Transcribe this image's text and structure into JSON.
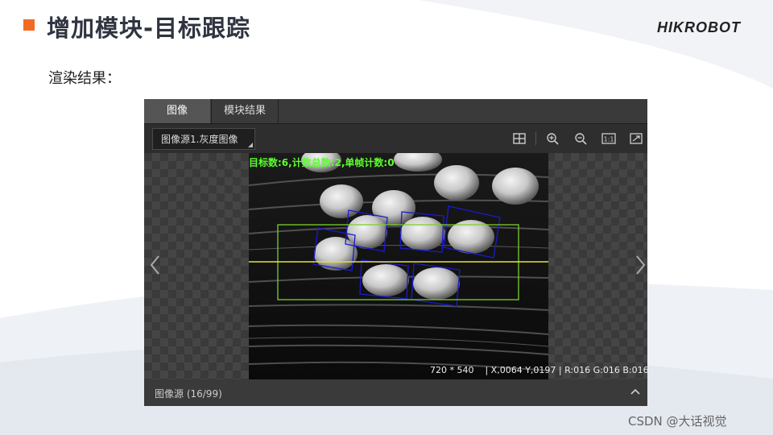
{
  "slide": {
    "title": "增加模块-目标跟踪",
    "brand": "HIKROBOT",
    "subtitle": "渲染结果：",
    "watermark": "CSDN @大话视觉"
  },
  "app": {
    "tabs": [
      {
        "label": "图像",
        "active": true
      },
      {
        "label": "模块结果",
        "active": false
      }
    ],
    "image_source_select": "图像源1.灰度图像",
    "toolbar_icons": [
      "grid-icon",
      "zoom-in-icon",
      "zoom-out-icon",
      "actual-size-icon",
      "fit-window-icon"
    ],
    "overlay_text": "目标数:6,计数总数:2,单帧计数:0",
    "status": {
      "resolution": "720 * 540",
      "coords": "| X,0064  Y,0197  | R:016  G:016  B:016"
    },
    "bottom_panel_label": "图像源 (16/99)"
  },
  "colors": {
    "accent": "#f26b21",
    "overlay_text": "#5dff2e",
    "roi_box": "#7ad12a",
    "line": "#e8e03a",
    "track_box": "#1a1ad6"
  }
}
